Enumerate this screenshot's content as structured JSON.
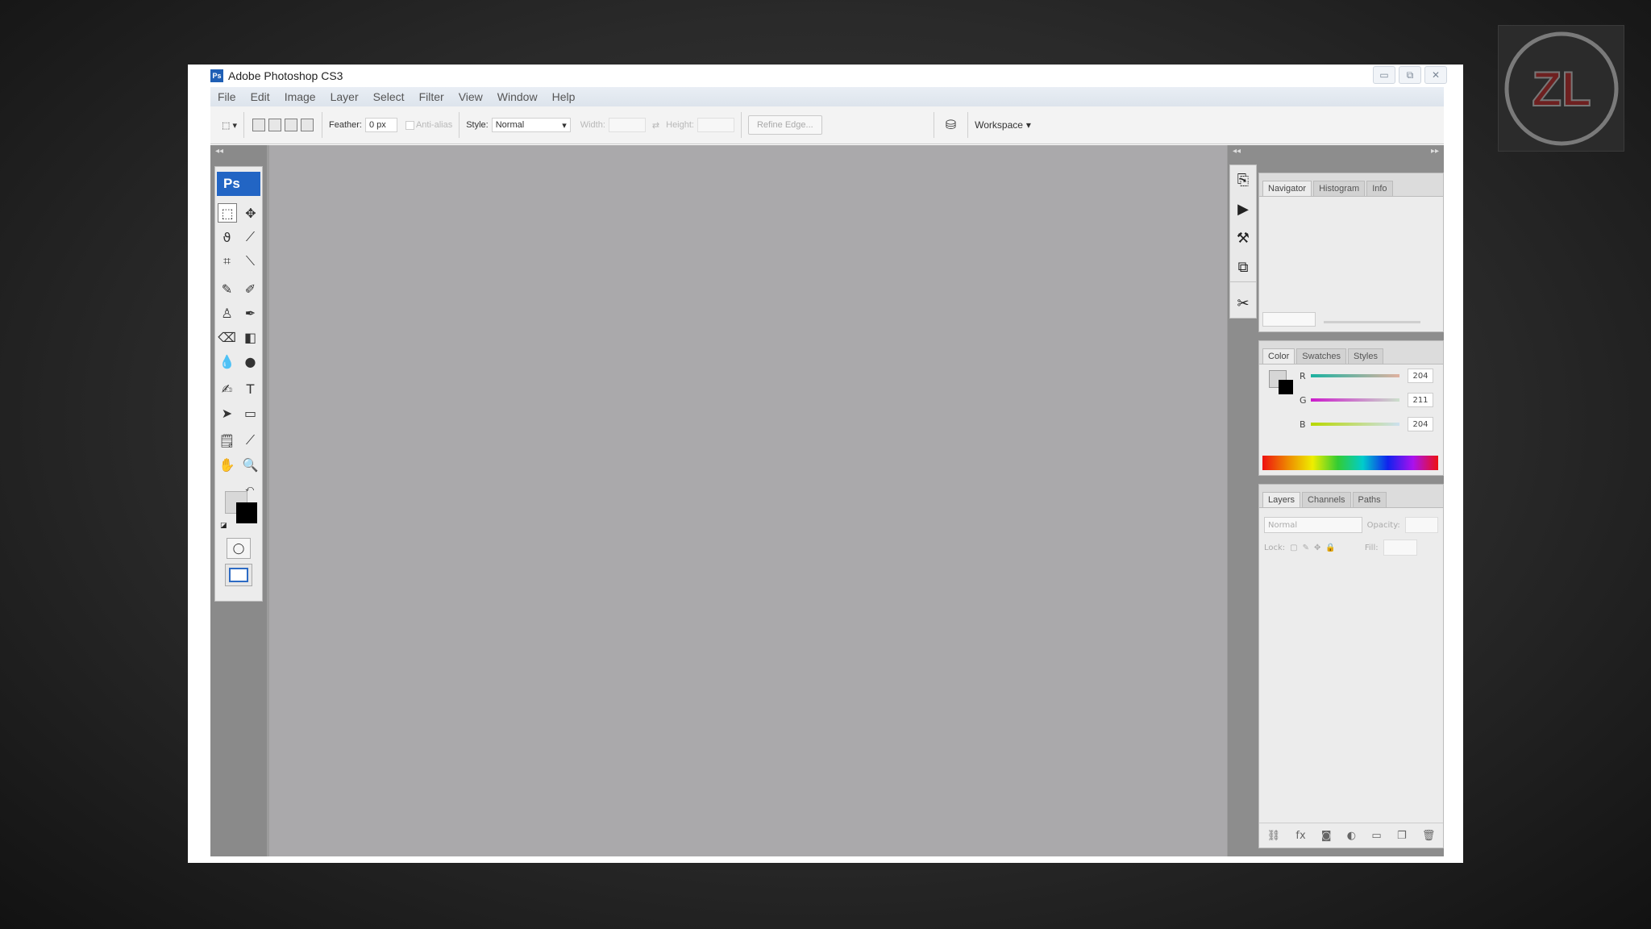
{
  "window": {
    "title": "Adobe Photoshop CS3",
    "app_icon": "Ps"
  },
  "window_controls": {
    "minimize": "▭",
    "restore": "⧉",
    "close": "✕"
  },
  "menu": [
    "File",
    "Edit",
    "Image",
    "Layer",
    "Select",
    "Filter",
    "View",
    "Window",
    "Help"
  ],
  "options": {
    "feather_label": "Feather:",
    "feather_value": "0 px",
    "antialias_label": "Anti-alias",
    "style_label": "Style:",
    "style_value": "Normal",
    "width_label": "Width:",
    "height_label": "Height:",
    "refine_edge_label": "Refine Edge...",
    "workspace_label": "Workspace"
  },
  "toolbox": {
    "badge": "Ps"
  },
  "panels": {
    "navigator": {
      "tabs": [
        "Navigator",
        "Histogram",
        "Info"
      ]
    },
    "color": {
      "tabs": [
        "Color",
        "Swatches",
        "Styles"
      ],
      "channels": [
        {
          "label": "R",
          "value": "204"
        },
        {
          "label": "G",
          "value": "211"
        },
        {
          "label": "B",
          "value": "204"
        }
      ]
    },
    "layers": {
      "tabs": [
        "Layers",
        "Channels",
        "Paths"
      ],
      "blend_mode": "Normal",
      "opacity_label": "Opacity:",
      "lock_label": "Lock:",
      "fill_label": "Fill:"
    }
  },
  "watermark": {
    "text": "ZL"
  },
  "colors": {
    "canvas": "#aaa9ab",
    "toolbox_badge": "#2265c4",
    "menu_bar": "#e4e9f0"
  }
}
